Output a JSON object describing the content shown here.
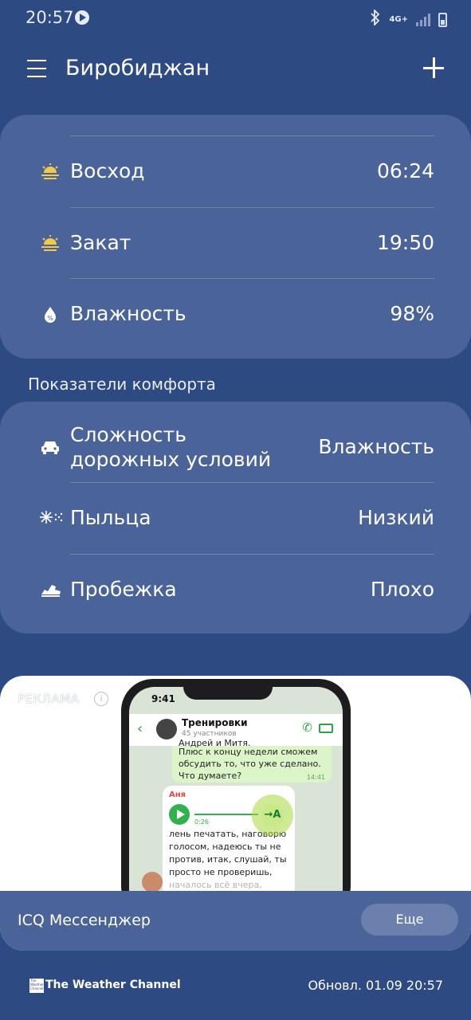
{
  "status_bar": {
    "time": "20:57",
    "network": "4G+",
    "icons": [
      "play-icon",
      "bluetooth-icon",
      "signal-icon",
      "battery-icon"
    ]
  },
  "header": {
    "city": "Биробиджан",
    "menu_icon": "hamburger-icon",
    "add_icon": "plus-icon"
  },
  "details": [
    {
      "icon": "sunrise-icon",
      "label": "Восход",
      "value": "06:24"
    },
    {
      "icon": "sunset-icon",
      "label": "Закат",
      "value": "19:50"
    },
    {
      "icon": "humidity-drop-icon",
      "label": "Влажность",
      "value": "98%"
    }
  ],
  "comfort": {
    "title": "Показатели комфорта",
    "items": [
      {
        "icon": "car-icon",
        "label_line1": "Сложность",
        "label_line2": "дорожных условий",
        "value": "Влажность"
      },
      {
        "icon": "pollen-icon",
        "label": "Пыльца",
        "value": "Низкий"
      },
      {
        "icon": "running-shoe-icon",
        "label": "Пробежка",
        "value": "Плохо"
      }
    ]
  },
  "ad": {
    "tag": "РЕКЛАМА",
    "phone": {
      "time": "9:41",
      "chat_name": "Тренировки",
      "chat_sub": "45 участников",
      "bubble1_top": "Андрей и Митя.",
      "bubble1_line1": "Плюс к концу недели сможем",
      "bubble1_line2": "обсудить то, что уже сделано.",
      "bubble1_line3": "Что думаете?",
      "bubble1_time": "14:41",
      "sender": "Аня",
      "duration": "0:26",
      "transcribe_label": "→A",
      "msg_line1": "лень печатать, наговорю",
      "msg_line2": "голосом, надеюсь ты не",
      "msg_line3": "против, итак, слушай, ты",
      "msg_line4": "просто не проверишь,",
      "msg_line5": "началось всё вчера,"
    },
    "title": "ICQ Мессенджер",
    "button": "Еще"
  },
  "footer": {
    "brand": "The Weather Channel",
    "logo_lines": [
      "The",
      "Weather",
      "Channel"
    ],
    "updated": "Обновл. 01.09 20:57"
  },
  "colors": {
    "background": "#2d4a82",
    "card": "#4a6399",
    "divider": "#6e84b3"
  }
}
